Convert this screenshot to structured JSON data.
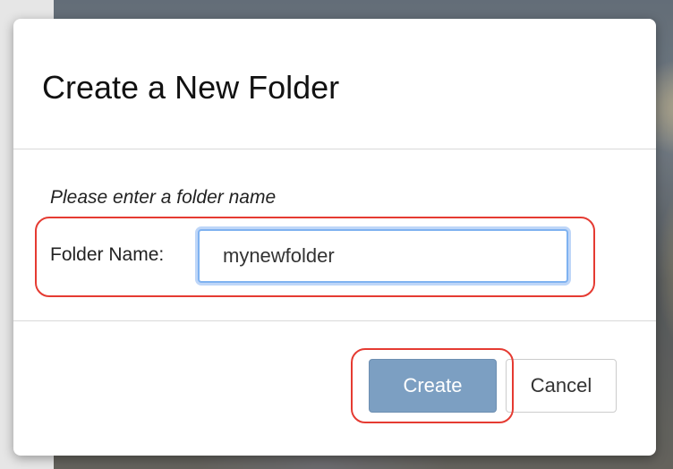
{
  "dialog": {
    "title": "Create a New Folder",
    "prompt": "Please enter a folder name",
    "field_label": "Folder Name:",
    "field_value": "mynewfolder",
    "create_label": "Create",
    "cancel_label": "Cancel"
  },
  "colors": {
    "create_button_bg": "#7c9fc2",
    "highlight_outline": "#e53b32",
    "input_focus_ring": "#7fb2f0"
  }
}
